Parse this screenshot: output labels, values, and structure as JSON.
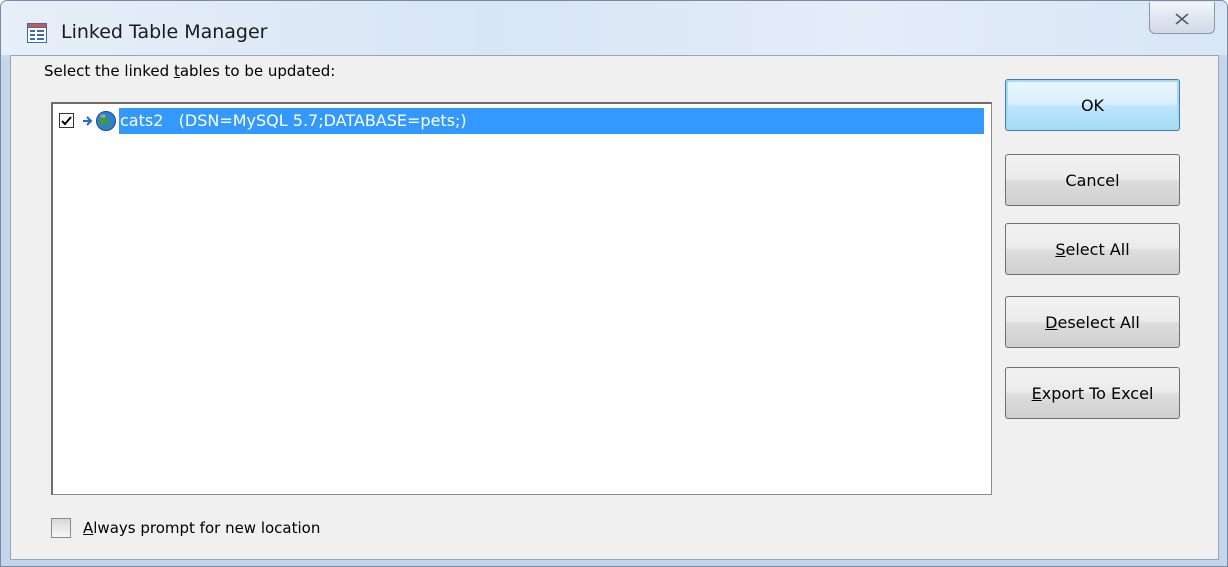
{
  "window": {
    "title": "Linked Table Manager",
    "close_glyph": "X"
  },
  "prompt": {
    "before": "Select the linked ",
    "mnemonic": "t",
    "after": "ables to be updated:"
  },
  "list": {
    "items": [
      {
        "checked": true,
        "name": "cats2",
        "connection": "(DSN=MySQL 5.7;DATABASE=pets;)",
        "text": "cats2   (DSN=MySQL 5.7;DATABASE=pets;)",
        "selected": true
      }
    ]
  },
  "always_prompt": {
    "checked": false,
    "mnemonic": "A",
    "rest": "lways prompt for new location"
  },
  "buttons": {
    "ok": {
      "label": "OK"
    },
    "cancel": {
      "label": "Cancel"
    },
    "select_all": {
      "mnemonic": "S",
      "rest": "elect All"
    },
    "deselect_all": {
      "mnemonic": "D",
      "rest": "eselect All"
    },
    "export_excel": {
      "mnemonic": "E",
      "rest": "xport To Excel"
    }
  },
  "colors": {
    "selection": "#3399ff",
    "dialog_bg": "#f0f0f0",
    "default_button": "#bee6fd"
  },
  "icons": {
    "title": "form-icon",
    "close": "close-icon",
    "link_arrow": "arrow-right-icon",
    "odbc": "globe-icon",
    "check": "checkmark-icon"
  }
}
